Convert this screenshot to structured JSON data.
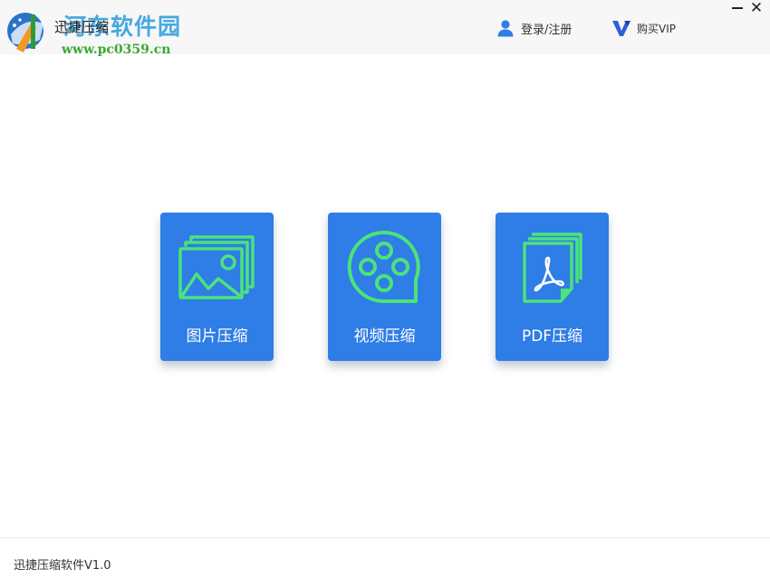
{
  "titlebar": {
    "app_title": "迅捷压缩",
    "login_label": "登录/注册",
    "vip_label": "购买VIP",
    "minimize_icon": "minimize-icon",
    "close_icon": "close-icon",
    "close_glyph": "✕"
  },
  "watermark": {
    "name": "河东软件园",
    "url": "www.pc0359.cn"
  },
  "cards": [
    {
      "label": "图片压缩",
      "icon": "image-icon"
    },
    {
      "label": "视频压缩",
      "icon": "film-reel-icon"
    },
    {
      "label": "PDF压缩",
      "icon": "pdf-file-icon"
    }
  ],
  "footer": {
    "version_text": "迅捷压缩软件V1.0"
  },
  "colors": {
    "card_blue": "#2f7de6",
    "icon_green": "#4be37a",
    "user_icon_blue": "#2f7de6"
  }
}
